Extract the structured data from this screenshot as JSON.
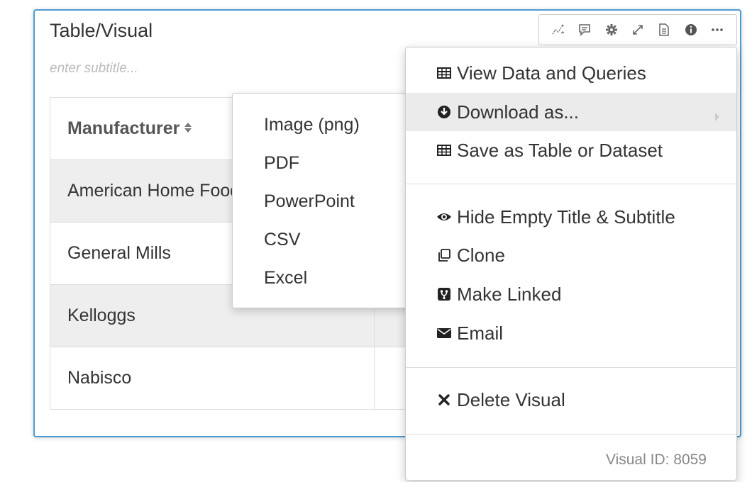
{
  "visual": {
    "title": "Table/Visual",
    "subtitle_placeholder": "enter subtitle...",
    "border_color": "#4d9bd4"
  },
  "toolbar": {
    "icons": [
      "sparkline-icon",
      "comment-icon",
      "gear-icon",
      "expand-icon",
      "document-icon",
      "info-icon",
      "more-icon"
    ]
  },
  "table": {
    "columns": [
      "Manufacturer"
    ],
    "rows": [
      [
        "American Home Food Products",
        ""
      ],
      [
        "General Mills",
        ""
      ],
      [
        "Kelloggs",
        ""
      ],
      [
        "Nabisco",
        ""
      ]
    ]
  },
  "download_submenu": {
    "items": [
      "Image (png)",
      "PDF",
      "PowerPoint",
      "CSV",
      "Excel"
    ]
  },
  "menu": {
    "view_data": "View Data and Queries",
    "download_as": "Download as...",
    "save_as": "Save as Table or Dataset",
    "hide_empty": "Hide Empty Title & Subtitle",
    "clone": "Clone",
    "make_linked": "Make Linked",
    "email": "Email",
    "delete_visual": "Delete Visual",
    "visual_id": "Visual ID: 8059",
    "active_item_bg": "#ebebeb"
  }
}
